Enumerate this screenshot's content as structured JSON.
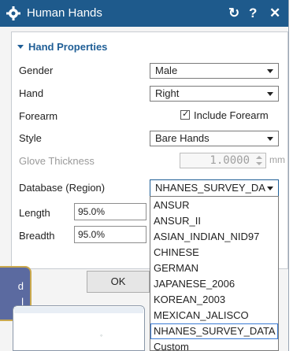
{
  "window": {
    "title": "Human Hands",
    "icon": "gear-icon",
    "buttons": {
      "reset": "↻",
      "help": "?",
      "close": "✕"
    },
    "accent": "#1e5a8c"
  },
  "section": {
    "title": "Hand Properties",
    "expanded": true
  },
  "form": {
    "gender": {
      "label": "Gender",
      "value": "Male"
    },
    "hand": {
      "label": "Hand",
      "value": "Right"
    },
    "forearm": {
      "label": "Forearm",
      "checkbox_label": "Include Forearm",
      "checked": true
    },
    "style": {
      "label": "Style",
      "value": "Bare Hands"
    },
    "glove_thickness": {
      "label": "Glove Thickness",
      "value": "1.0000",
      "unit": "mm",
      "enabled": false
    },
    "database": {
      "label": "Database (Region)",
      "value": "NHANES_SURVEY_DA"
    },
    "length": {
      "label": "Length",
      "value": "95.0%"
    },
    "breadth": {
      "label": "Breadth",
      "value": "95.0%"
    }
  },
  "database_options": [
    "ANSUR",
    "ANSUR_II",
    "ASIAN_INDIAN_NID97",
    "CHINESE",
    "GERMAN",
    "JAPANESE_2006",
    "KOREAN_2003",
    "MEXICAN_JALISCO",
    "NHANES_SURVEY_DATA",
    "Custom"
  ],
  "selected_option": "NHANES_SURVEY_DATA",
  "buttons": {
    "ok": "OK"
  },
  "tooltip": {
    "line1": "d",
    "line2": "l"
  }
}
